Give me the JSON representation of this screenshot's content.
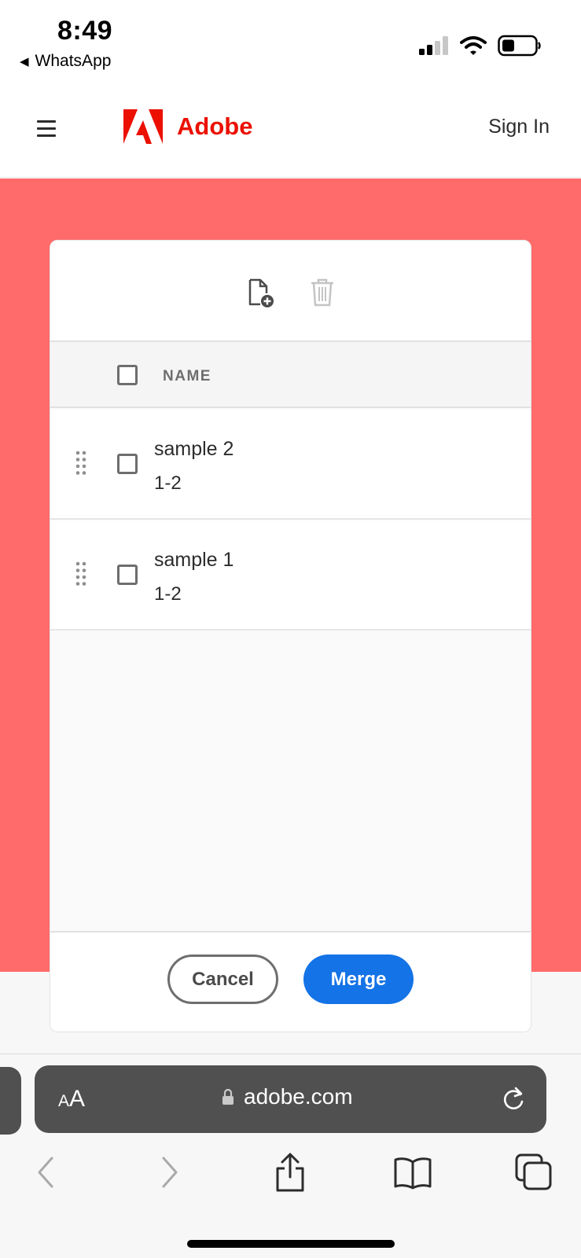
{
  "status_bar": {
    "time": "8:49",
    "back_app_label": "WhatsApp",
    "icons": [
      "cellular-signal-icon",
      "wifi-icon",
      "battery-icon"
    ]
  },
  "header": {
    "brand": "Adobe",
    "sign_in_label": "Sign In",
    "brand_color": "#eb1000"
  },
  "card": {
    "toolbar_icons": [
      "add-file-icon",
      "trash-icon"
    ],
    "column_header": "NAME",
    "files": [
      {
        "name": "sample 2",
        "pages": "1-2"
      },
      {
        "name": "sample 1",
        "pages": "1-2"
      }
    ],
    "cancel_label": "Cancel",
    "merge_label": "Merge",
    "accent_color": "#1473e6",
    "hero_color": "#ff6b6b"
  },
  "browser": {
    "text_size_label_small": "A",
    "text_size_label_large": "A",
    "url": "adobe.com",
    "nav_icons": [
      "back-icon",
      "forward-icon",
      "share-icon",
      "bookmarks-icon",
      "tabs-icon"
    ]
  }
}
